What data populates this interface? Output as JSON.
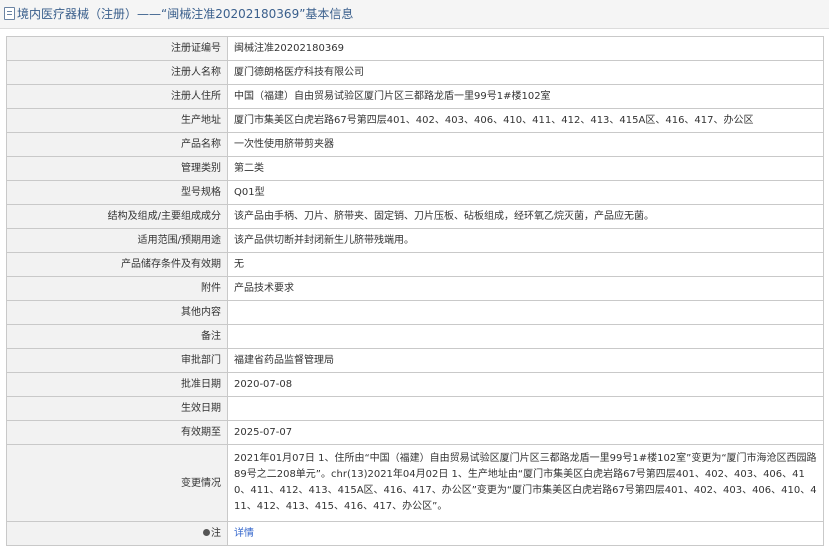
{
  "header": {
    "title": "境内医疗器械（注册）——“闽械注准20202180369”基本信息"
  },
  "rows": [
    {
      "label": "注册证编号",
      "value": "闽械注准20202180369"
    },
    {
      "label": "注册人名称",
      "value": "厦门德朗格医疗科技有限公司"
    },
    {
      "label": "注册人住所",
      "value": "中国（福建）自由贸易试验区厦门片区三都路龙盾一里99号1#楼102室"
    },
    {
      "label": "生产地址",
      "value": "厦门市集美区白虎岩路67号第四层401、402、403、406、410、411、412、413、415A区、416、417、办公区"
    },
    {
      "label": "产品名称",
      "value": "一次性使用脐带剪夹器"
    },
    {
      "label": "管理类别",
      "value": "第二类"
    },
    {
      "label": "型号规格",
      "value": "Q01型"
    },
    {
      "label": "结构及组成/主要组成成分",
      "value": "该产品由手柄、刀片、脐带夹、固定销、刀片压板、砧板组成，经环氧乙烷灭菌，产品应无菌。"
    },
    {
      "label": "适用范围/预期用途",
      "value": "该产品供切断并封闭新生儿脐带残端用。"
    },
    {
      "label": "产品储存条件及有效期",
      "value": "无"
    },
    {
      "label": "附件",
      "value": "产品技术要求"
    },
    {
      "label": "其他内容",
      "value": ""
    },
    {
      "label": "备注",
      "value": ""
    },
    {
      "label": "审批部门",
      "value": "福建省药品监督管理局"
    },
    {
      "label": "批准日期",
      "value": "2020-07-08"
    },
    {
      "label": "生效日期",
      "value": ""
    },
    {
      "label": "有效期至",
      "value": "2025-07-07"
    }
  ],
  "change": {
    "label": "变更情况",
    "value": "2021年01月07日 1、住所由“中国（福建）自由贸易试验区厦门片区三都路龙盾一里99号1#楼102室”变更为“厦门市海沧区西园路89号之二208单元”。chr(13)2021年04月02日 1、生产地址由“厦门市集美区白虎岩路67号第四层401、402、403、406、410、411、412、413、415A区、416、417、办公区”变更为“厦门市集美区白虎岩路67号第四层401、402、403、406、410、411、412、413、415、416、417、办公区”。"
  },
  "note": {
    "label": "注",
    "link_text": "详情",
    "icon": "note-icon"
  }
}
